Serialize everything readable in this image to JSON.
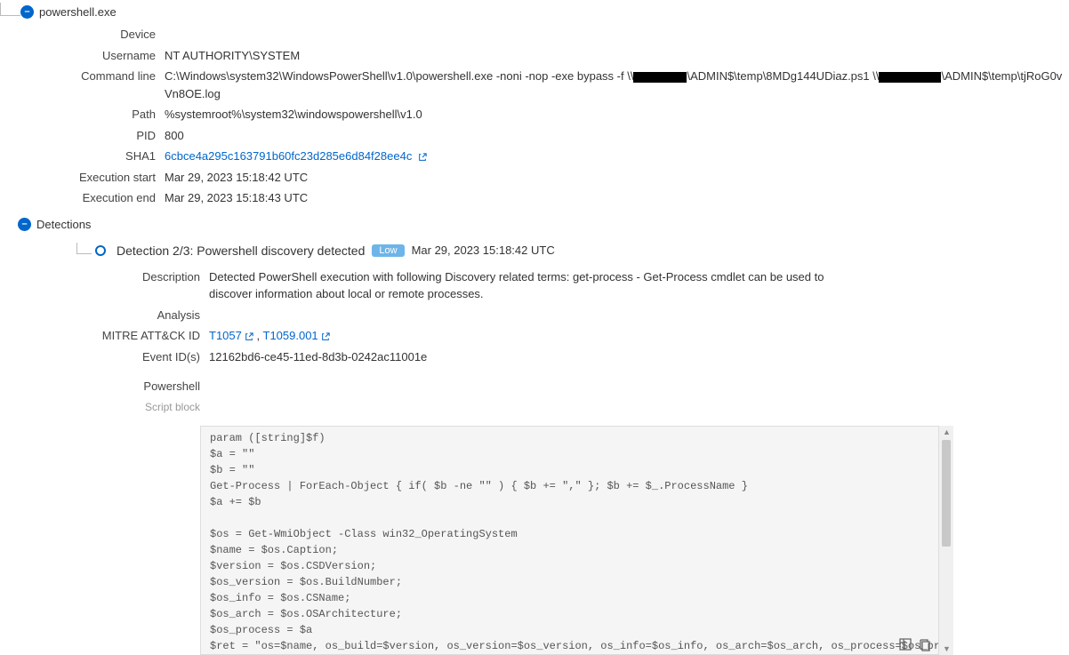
{
  "process": {
    "name": "powershell.exe",
    "fields": {
      "device_label": "Device",
      "device_value": "",
      "username_label": "Username",
      "username_value": "NT AUTHORITY\\SYSTEM",
      "cmdline_label": "Command line",
      "cmdline_prefix": "C:\\Windows\\system32\\WindowsPowerShell\\v1.0\\powershell.exe -noni -nop -exe bypass -f \\\\",
      "cmdline_mid": "\\ADMIN$\\temp\\8MDg144UDiaz.ps1 \\\\",
      "cmdline_suffix": "\\ADMIN$\\temp\\tjRoG0vVn8OE.log",
      "path_label": "Path",
      "path_value": "%systemroot%\\system32\\windowspowershell\\v1.0",
      "pid_label": "PID",
      "pid_value": "800",
      "sha1_label": "SHA1",
      "sha1_value": "6cbce4a295c163791b60fc23d285e6d84f28ee4c",
      "exec_start_label": "Execution start",
      "exec_start_value": "Mar 29, 2023 15:18:42 UTC",
      "exec_end_label": "Execution end",
      "exec_end_value": "Mar 29, 2023 15:18:43 UTC"
    }
  },
  "detections_label": "Detections",
  "detection": {
    "title": "Detection 2/3: Powershell discovery detected",
    "severity": "Low",
    "timestamp": "Mar 29, 2023 15:18:42 UTC",
    "description_label": "Description",
    "description_value": "Detected PowerShell execution with following Discovery related terms: get-process - Get-Process cmdlet can be used to discover information about local or remote processes.",
    "analysis_label": "Analysis",
    "mitre_label": "MITRE ATT&CK ID",
    "mitre1": "T1057",
    "mitre_sep": " , ",
    "mitre2": "T1059.001",
    "eventid_label": "Event ID(s)",
    "eventid_value": "12162bd6-ce45-11ed-8d3b-0242ac11001e",
    "ps_label": "Powershell",
    "script_label": "Script block",
    "script_block": "param ([string]$f)\n$a = \"\"\n$b = \"\"\nGet-Process | ForEach-Object { if( $b -ne \"\" ) { $b += \",\" }; $b += $_.ProcessName }\n$a += $b\n\n$os = Get-WmiObject -Class win32_OperatingSystem\n$name = $os.Caption;\n$version = $os.CSDVersion;\n$os_version = $os.BuildNumber;\n$os_info = $os.CSName;\n$os_arch = $os.OSArchitecture;\n$os_process = $a\n$ret = \"os=$name, os_build=$version, os_version=$os_version, os_info=$os_info, os_arch=$os_arch, os_process=$os_process\""
  }
}
